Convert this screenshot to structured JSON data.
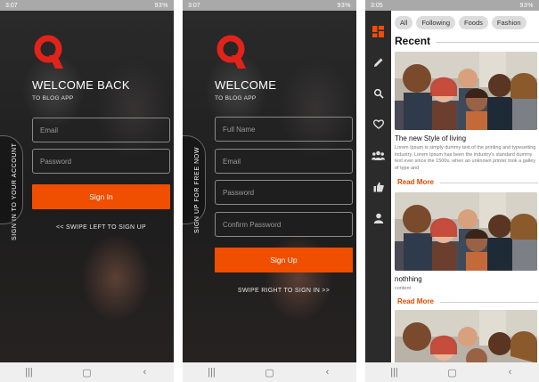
{
  "colors": {
    "accent": "#f04e00",
    "dark_bg": "#1d1d1d",
    "sidebar_bg": "#2b2b2b",
    "chip_bg": "#dcdcdc"
  },
  "signin": {
    "status_time": "3:07",
    "status_battery": "93%",
    "welcome": "WELCOME BACK",
    "subtitle": "TO BLOG APP",
    "email_placeholder": "Email",
    "password_placeholder": "Password",
    "button_label": "Sign In",
    "swipe_hint": "<< SWIPE LEFT TO SIGN UP",
    "side_label": "SIGN IN TO YOUR ACCOUNT"
  },
  "signup": {
    "status_time": "3:07",
    "status_battery": "93%",
    "welcome": "WELCOME",
    "subtitle": "TO BLOG APP",
    "fullname_placeholder": "Full Name",
    "email_placeholder": "Email",
    "password_placeholder": "Password",
    "confirm_placeholder": "Confirm Password",
    "button_label": "Sign Up",
    "swipe_hint": "SWIPE RIGHT TO SIGN IN >>",
    "side_label": "SIGN UP FOR FREE NOW"
  },
  "feed": {
    "status_time": "3:05",
    "status_battery": "93%",
    "chips": [
      "All",
      "Following",
      "Foods",
      "Fashion"
    ],
    "recent_title": "Recent",
    "posts": [
      {
        "title": "The new Style of living",
        "body": "Lorem Ipsum is simply dummy text of the printing and typesetting industry. Lorem Ipsum has been the industry's standard dummy text ever since the 1500s, when an unknown printer took a galley of type and",
        "read_more": "Read More"
      },
      {
        "title": "nothhing",
        "body": "content",
        "read_more": "Read More"
      }
    ],
    "sidebar_icons": [
      "dashboard-icon",
      "pencil-icon",
      "search-icon",
      "heart-icon",
      "people-icon",
      "thumbs-up-icon",
      "person-icon"
    ]
  },
  "nav": {
    "recent": "|||",
    "home": "▢",
    "back": "‹"
  }
}
